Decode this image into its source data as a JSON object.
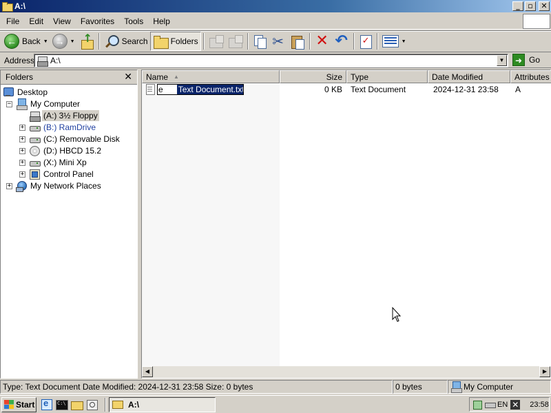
{
  "window": {
    "title": "A:\\",
    "buttons": {
      "minimize": "_",
      "maximize": "▫",
      "close": "✕"
    }
  },
  "menu": [
    "File",
    "Edit",
    "View",
    "Favorites",
    "Tools",
    "Help"
  ],
  "toolbar": {
    "back_label": "Back",
    "search_label": "Search",
    "folders_label": "Folders",
    "icons": [
      "back-icon",
      "forward-icon",
      "up-folder-icon",
      "search-icon",
      "folders-icon",
      "move-to-icon",
      "copy-to-icon",
      "copy-icon",
      "cut-icon",
      "paste-icon",
      "delete-icon",
      "undo-icon",
      "properties-icon",
      "views-icon"
    ]
  },
  "address": {
    "label": "Address",
    "value": "A:\\",
    "go_label": "Go"
  },
  "folders_pane": {
    "title": "Folders",
    "close": "✕",
    "tree": [
      {
        "label": "Desktop",
        "icon": "desktop-icon",
        "expander": ""
      },
      {
        "label": "My Computer",
        "icon": "my-computer-icon",
        "expander": "−"
      },
      {
        "label": "(A:) 3½ Floppy",
        "icon": "floppy-icon",
        "expander": "",
        "selected": true
      },
      {
        "label": "(B:) RamDrive",
        "icon": "drive-icon",
        "expander": "+"
      },
      {
        "label": "(C:) Removable Disk",
        "icon": "drive-icon",
        "expander": "+"
      },
      {
        "label": "(D:) HBCD 15.2",
        "icon": "cd-icon",
        "expander": "+"
      },
      {
        "label": "(X:) Mini Xp",
        "icon": "drive-icon",
        "expander": "+"
      },
      {
        "label": "Control Panel",
        "icon": "control-panel-icon",
        "expander": "+"
      },
      {
        "label": "My Network Places",
        "icon": "network-icon",
        "expander": "+"
      }
    ]
  },
  "file_list": {
    "columns": [
      "Name",
      "Size",
      "Type",
      "Date Modified",
      "Attributes"
    ],
    "rows": [
      {
        "name_prefix": "e",
        "name_selected": "Text Document.txt",
        "size": "0 KB",
        "type": "Text Document",
        "modified": "2024-12-31 23:58",
        "attributes": "A"
      }
    ]
  },
  "status": {
    "details": "Type: Text Document Date Modified: 2024-12-31 23:58 Size: 0 bytes",
    "size": "0 bytes",
    "zone": "My Computer"
  },
  "taskbar": {
    "start_label": "Start",
    "task_label": "A:\\",
    "language": "EN",
    "clock": "23:58"
  }
}
